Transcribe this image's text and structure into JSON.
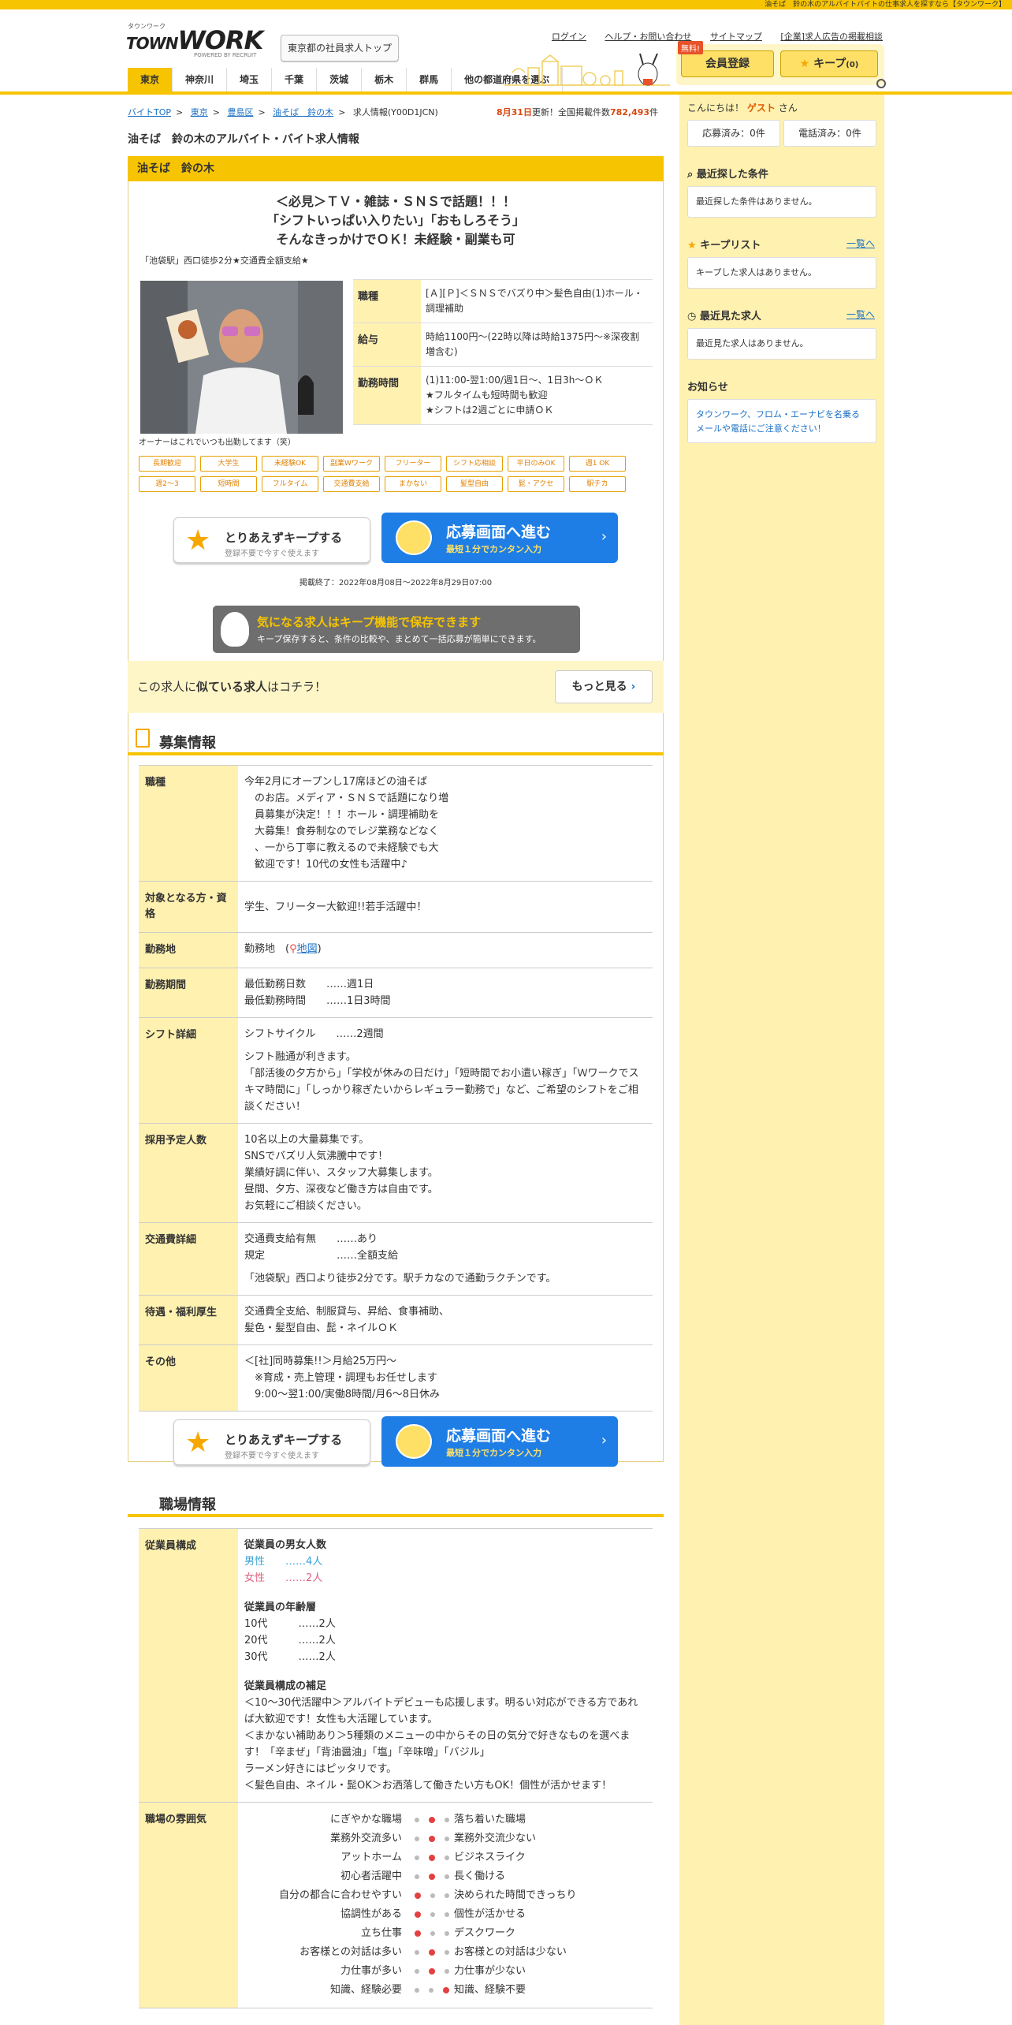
{
  "top_strip": "油そば　鈴の木のアルバイトバイトの仕事求人を探すなら【タウンワーク】",
  "logo": {
    "small": "タウンワーク",
    "word_t": "TOWN",
    "word_w": "WORK",
    "rec": "POWERED BY RECRUIT"
  },
  "header": {
    "region_button": "東京都の社員求人トップ",
    "links": [
      "ログイン",
      "ヘルプ・お問い合わせ",
      "サイトマップ",
      "[企業]求人広告の掲載相談"
    ],
    "member_free": "無料!",
    "member_button": "会員登録",
    "keep_button": "キープ",
    "keep_count": "(0)"
  },
  "nav": {
    "tabs": [
      "東京",
      "神奈川",
      "埼玉",
      "千葉",
      "茨城",
      "栃木",
      "群馬",
      "他の都道府県を選ぶ"
    ]
  },
  "breadcrumb": [
    "バイトTOP",
    "東京",
    "豊島区",
    "油そば　鈴の木",
    "求人情報(Y00D1JCN)"
  ],
  "updated": {
    "date": "8月31日",
    "mid": "更新！全国掲載件数",
    "count": "782,493",
    "unit": "件"
  },
  "page_title": "油そば　鈴の木のアルバイト・バイト求人情報",
  "job": {
    "shop_name": "油そば　鈴の木",
    "catch_lines": [
      "＜必見＞ＴＶ・雑誌・ＳＮＳで話題！！！",
      "「シフトいっぱい入りたい」「おもしろそう」",
      "そんなきっかけでＯＫ！未経験・副業も可"
    ],
    "subcatch": "「池袋駅」西口徒歩2分★交通費全額支給★",
    "photo_caption": "オーナーはこれでいつも出勤してます（笑）",
    "summary": [
      {
        "k": "職種",
        "v": "[Ａ][Ｐ]＜ＳＮＳでバズり中＞髪色自由(1)ホール・調理補助"
      },
      {
        "k": "給与",
        "v": "時給1100円～(22時以降は時給1375円～※深夜割増含む)"
      },
      {
        "k": "勤務時間",
        "v": "(1)11:00-翌1:00/週1日～、1日3h～ＯＫ\n★フルタイムも短時間も歓迎\n★シフトは2週ごとに申請ＯＫ"
      }
    ],
    "tags": [
      "長期歓迎",
      "大学生",
      "未経験OK",
      "副業Wワーク",
      "フリーター",
      "シフト応相談",
      "平日のみOK",
      "週1 OK",
      "週2～3",
      "短時間",
      "フルタイム",
      "交通費支給",
      "まかない",
      "髪型自由",
      "髭・アクセ",
      "駅チカ"
    ],
    "keep_title": "とりあえずキープする",
    "keep_sub": "登録不要で今すぐ使えます",
    "apply_title": "応募画面へ進む",
    "apply_sub": "最短１分でカンタン入力",
    "period": "掲載終了：2022年08月08日～2022年8月29日07:00",
    "keep_banner_title": "気になる求人はキープ機能で保存できます",
    "keep_banner_sub": "キープ保存すると、条件の比較や、まとめて一括応募が簡単にできます。",
    "similar_a": "この求人に",
    "similar_b": "似ている求人",
    "similar_c": "はコチラ！",
    "similar_more": "もっと見る"
  },
  "recruit": {
    "title": "募集情報",
    "job_k": "職種",
    "job_v": "今年2月にオープンし17席ほどの油そば\n　のお店。メディア・ＳＮＳで話題になり増\n　員募集が決定！！！ホール・調理補助を\n　大募集！食券制なのでレジ業務などなく\n　、一から丁寧に教えるので未経験でも大\n　歓迎です！10代の女性も活躍中♪",
    "target_k": "対象となる方・資格",
    "target_v": "学生、フリーター大歓迎!!若手活躍中！",
    "place_k": "勤務地",
    "place_v": "勤務地　(",
    "place_link": "地図",
    "place_close": ")",
    "term_k": "勤務期間",
    "term_v": "最低勤務日数　　……週1日\n最低勤務時間　　……1日3時間",
    "shift_k": "シフト詳細",
    "shift_v1": "シフトサイクル　　……2週間",
    "shift_v2": "シフト融通が利きます。\n「部活後の夕方から」「学校が休みの日だけ」「短時間でお小遣い稼ぎ」「Ｗワークでスキマ時間に」「しっかり稼ぎたいからレギュラー勤務で」など、ご希望のシフトをご相談ください！",
    "hire_k": "採用予定人数",
    "hire_v": "10名以上の大量募集です。\nSNSでバズリ人気沸騰中です！\n業績好調に伴い、スタッフ大募集します。\n昼間、夕方、深夜など働き方は自由です。\nお気軽にご相談ください。",
    "trans_k": "交通費詳細",
    "trans_v1": "交通費支給有無　　……あり\n規定　　　　　　　……全額支給",
    "trans_v2": "「池袋駅」西口より徒歩2分です。駅チカなので通勤ラクチンです。",
    "welfare_k": "待遇・福利厚生",
    "welfare_v": "交通費全支給、制服貸与、昇給、食事補助、\n髪色・髪型自由、髭・ネイルＯＫ",
    "other_k": "その他",
    "other_v": "＜[社]同時募集!!＞月給25万円～\n　※育成・売上管理・調理もお任せします\n　9:00～翌1:00/実働8時間/月6～8日休み"
  },
  "workplace": {
    "title": "職場情報",
    "staff_k": "従業員構成",
    "gender_h": "従業員の男女人数",
    "male": "男性　　……4人",
    "female": "女性　　……2人",
    "age_h": "従業員の年齢層",
    "ages": [
      "10代　　　……2人",
      "20代　　　……2人",
      "30代　　　……2人"
    ],
    "note_h": "従業員構成の補足",
    "note_v": "＜10～30代活躍中＞アルバイトデビューも応援します。明るい対応ができる方であれば大歓迎です！女性も大活躍しています。\n＜まかない補助あり＞5種類のメニューの中からその日の気分で好きなものを選べます！「辛まぜ」「背油醤油」「塩」「辛味噌」「バジル」\nラーメン好きにはピッタリです。\n＜髪色自由、ネイル・髭OK＞お洒落して働きたい方もOK！個性が活かせます！",
    "atmos_k": "職場の雰囲気",
    "atmos": [
      {
        "l": "にぎやかな職場",
        "r": "落ち着いた職場",
        "pos": 2
      },
      {
        "l": "業務外交流多い",
        "r": "業務外交流少ない",
        "pos": 2
      },
      {
        "l": "アットホーム",
        "r": "ビジネスライク",
        "pos": 2
      },
      {
        "l": "初心者活躍中",
        "r": "長く働ける",
        "pos": 2
      },
      {
        "l": "自分の都合に合わせやすい",
        "r": "決められた時間できっちり",
        "pos": 1
      },
      {
        "l": "協調性がある",
        "r": "個性が活かせる",
        "pos": 1
      },
      {
        "l": "立ち仕事",
        "r": "デスクワーク",
        "pos": 1
      },
      {
        "l": "お客様との対話は多い",
        "r": "お客様との対話は少ない",
        "pos": 2
      },
      {
        "l": "力仕事が多い",
        "r": "力仕事が少ない",
        "pos": 2
      },
      {
        "l": "知識、経験必要",
        "r": "知識、経験不要",
        "pos": 3
      }
    ]
  },
  "sidebar": {
    "greet_a": "こんにちは！",
    "guest": "ゲスト",
    "greet_b": "さん",
    "applied": "応募済み：0件",
    "called": "電話済み：0件",
    "recent_search_h": "最近探した条件",
    "recent_search_v": "最近探した条件はありません。",
    "keep_list_h": "キープリスト",
    "keep_list_more": "一覧へ",
    "keep_list_v": "キープした求人はありません。",
    "recent_view_h": "最近見た求人",
    "recent_view_more": "一覧へ",
    "recent_view_v": "最近見た求人はありません。",
    "notice_h": "お知らせ",
    "notice_link": "タウンワーク、フロム・エーナビを名乗るメールや電話にご注意ください！"
  }
}
